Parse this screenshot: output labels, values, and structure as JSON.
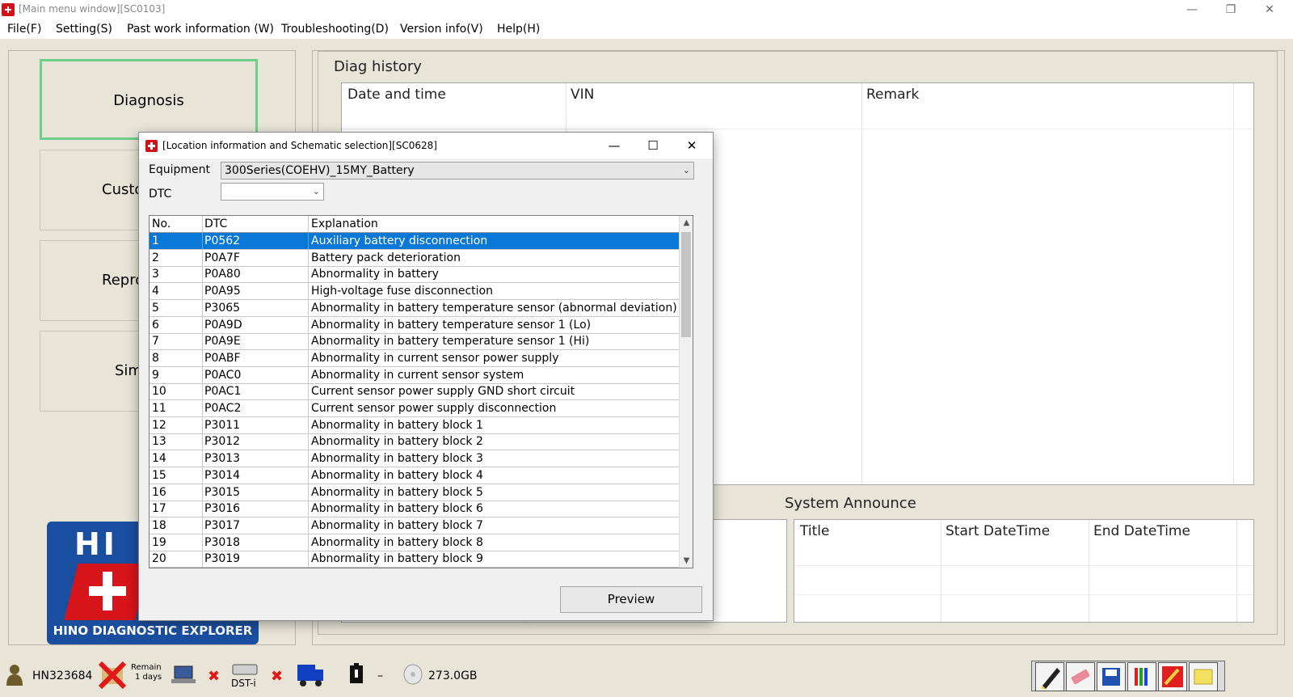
{
  "window": {
    "title": "[Main menu window][SC0103]",
    "minimize": "—",
    "restore": "❐",
    "close": "✕"
  },
  "menu": [
    "File(F)",
    "Setting(S)",
    "Past work information (W)",
    "Troubleshooting(D)",
    "Version info(V)",
    "Help(H)"
  ],
  "left_menu": {
    "diagnosis": "Diagnosis",
    "customize": "Custo",
    "reprogram": "Repro",
    "simulation": "Sim"
  },
  "logo": {
    "text": "HINO DIAGNOSTIC EXPLORER",
    "letters": "HI"
  },
  "diag_history": {
    "title": "Diag history",
    "columns": [
      "Date and time",
      "VIN",
      "Remark"
    ]
  },
  "system_announce": {
    "title": "System Announce",
    "columns": [
      "Title",
      "Start DateTime",
      "End DateTime"
    ]
  },
  "dialog": {
    "title": "[Location information and Schematic selection][SC0628]",
    "minimize": "—",
    "maximize": "☐",
    "close": "✕",
    "equipment_label": "Equipment",
    "equipment_value": "300Series(COEHV)_15MY_Battery",
    "dtc_label": "DTC",
    "dtc_value": "",
    "dropdown_arrow": "⌄",
    "list_headers": [
      "No.",
      "DTC",
      "Explanation"
    ],
    "rows": [
      [
        "1",
        "P0562",
        "Auxiliary battery disconnection"
      ],
      [
        "2",
        "P0A7F",
        "Battery pack deterioration"
      ],
      [
        "3",
        "P0A80",
        "Abnormality in battery"
      ],
      [
        "4",
        "P0A95",
        "High-voltage fuse disconnection"
      ],
      [
        "5",
        "P3065",
        "Abnormality in battery temperature sensor (abnormal deviation)"
      ],
      [
        "6",
        "P0A9D",
        "Abnormality in battery temperature sensor 1 (Lo)"
      ],
      [
        "7",
        "P0A9E",
        "Abnormality in battery temperature sensor 1 (Hi)"
      ],
      [
        "8",
        "P0ABF",
        "Abnormality in current sensor power supply"
      ],
      [
        "9",
        "P0AC0",
        "Abnormality in current sensor system"
      ],
      [
        "10",
        "P0AC1",
        "Current sensor power supply GND short circuit"
      ],
      [
        "11",
        "P0AC2",
        "Current sensor power supply disconnection"
      ],
      [
        "12",
        "P3011",
        "Abnormality in battery block 1"
      ],
      [
        "13",
        "P3012",
        "Abnormality in battery block 2"
      ],
      [
        "14",
        "P3013",
        "Abnormality in battery block 3"
      ],
      [
        "15",
        "P3014",
        "Abnormality in battery block 4"
      ],
      [
        "16",
        "P3015",
        "Abnormality in battery block 5"
      ],
      [
        "17",
        "P3016",
        "Abnormality in battery block 6"
      ],
      [
        "18",
        "P3017",
        "Abnormality in battery block 7"
      ],
      [
        "19",
        "P3018",
        "Abnormality in battery block 8"
      ],
      [
        "20",
        "P3019",
        "Abnormality in battery block 9"
      ]
    ],
    "preview_button": "Preview"
  },
  "status": {
    "user_id": "HN323684",
    "remain_label": "Remain",
    "remain_days": "1 days",
    "device": "DST-i",
    "disk": "273.0GB",
    "dash": "–",
    "x_mark": "✖"
  },
  "icons": [
    "user-icon",
    "license-x-icon",
    "laptop-icon",
    "dst-device-icon",
    "truck-icon",
    "battery-icon",
    "disk-icon",
    "pen-icon",
    "eraser-icon",
    "save-icon",
    "palette-icon",
    "color-pen-icon",
    "note-icon"
  ],
  "colors": {
    "selection": "#0a78d7",
    "accent_green": "#6dcf8a",
    "brand_red": "#d7141a",
    "brand_blue": "#1a4fa0"
  }
}
